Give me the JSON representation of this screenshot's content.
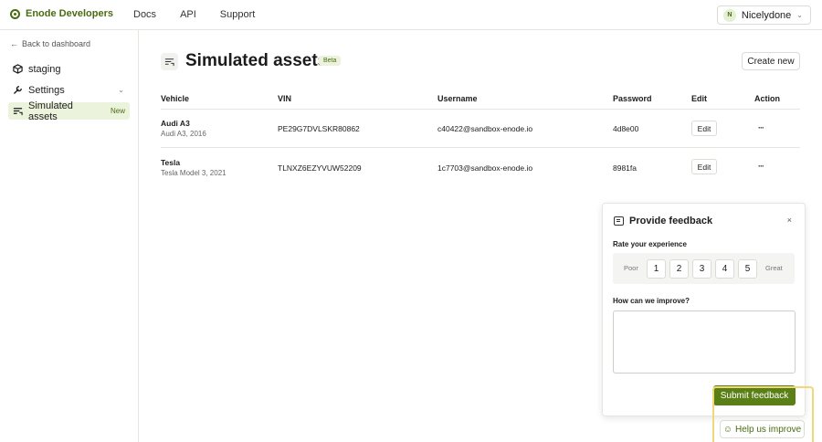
{
  "header": {
    "brand": "Enode Developers",
    "nav": [
      "Docs",
      "API",
      "Support"
    ],
    "user": {
      "initial": "N",
      "name": "Nicelydone"
    }
  },
  "sidebar": {
    "back_label": "Back to dashboard",
    "items": [
      {
        "label": "staging",
        "icon": "cube-icon"
      },
      {
        "label": "Settings",
        "icon": "wrench-icon"
      },
      {
        "label": "Simulated assets",
        "icon": "sliders-icon",
        "badge": "New",
        "active": true
      }
    ]
  },
  "main": {
    "title": "Simulated assets",
    "badge": "Beta",
    "create_label": "Create new",
    "columns": [
      "Vehicle",
      "VIN",
      "Username",
      "Password",
      "Edit",
      "Action"
    ],
    "rows": [
      {
        "vehicle": "Audi A3",
        "model": "Audi A3, 2016",
        "vin": "PE29G7DVLSKR80862",
        "username": "c40422@sandbox-enode.io",
        "password": "4d8e00",
        "edit": "Edit",
        "action": "···"
      },
      {
        "vehicle": "Tesla",
        "model": "Tesla Model 3, 2021",
        "vin": "TLNXZ6EZYVUW52209",
        "username": "1c7703@sandbox-enode.io",
        "password": "8981fa",
        "edit": "Edit",
        "action": "···"
      }
    ]
  },
  "feedback": {
    "title": "Provide feedback",
    "close": "×",
    "rate_label": "Rate your experience",
    "poor": "Poor",
    "great": "Great",
    "ratings": [
      "1",
      "2",
      "3",
      "4",
      "5"
    ],
    "improve_label": "How can we improve?",
    "improve_value": "",
    "submit_label": "Submit feedback"
  },
  "help": {
    "label": "Help us improve"
  },
  "colors": {
    "accent": "#4a6b12",
    "submit": "#5a7f16",
    "active_bg": "#ecf3dd",
    "highlight_border": "#f0d878"
  }
}
